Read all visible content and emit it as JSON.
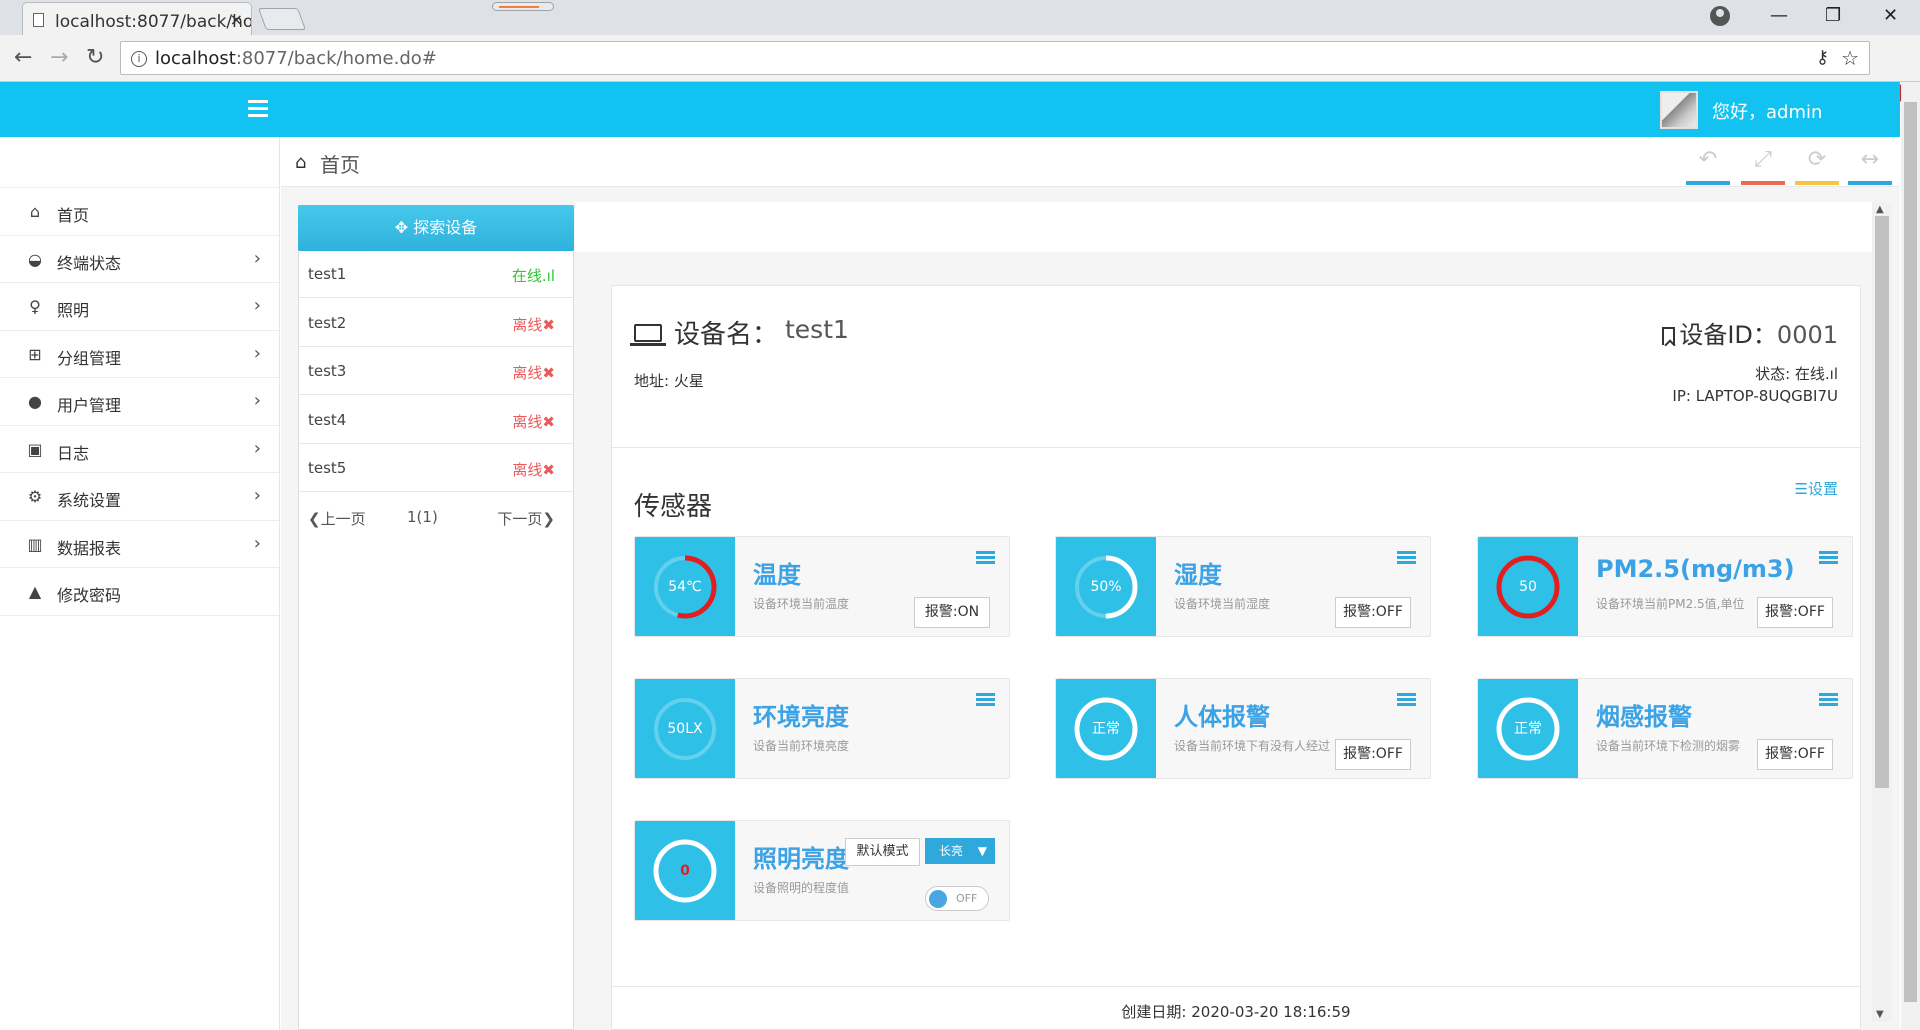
{
  "browser": {
    "tab_title": "localhost:8077/back/ho",
    "tab_close": "×",
    "url_host": "localhost",
    "url_path": ":8077/back/home.do#",
    "back": "←",
    "forward": "→",
    "reload": "↻",
    "info": "i",
    "key": "⚷",
    "star": "☆",
    "minimize": "—",
    "restore": "❐",
    "close": "✕",
    "ext": "●"
  },
  "header": {
    "greeting": "您好，admin"
  },
  "sidebar": {
    "items": [
      {
        "label": "首页",
        "icon": "home-icon",
        "glyph": "⌂",
        "arrow": ""
      },
      {
        "label": "终端状态",
        "icon": "dashboard-icon",
        "glyph": "◒",
        "arrow": "›"
      },
      {
        "label": "照明",
        "icon": "lightbulb-icon",
        "glyph": "♀",
        "arrow": "›"
      },
      {
        "label": "分组管理",
        "icon": "sitemap-icon",
        "glyph": "⊞",
        "arrow": "›"
      },
      {
        "label": "用户管理",
        "icon": "user-icon",
        "glyph": "●",
        "arrow": "›"
      },
      {
        "label": "日志",
        "icon": "archive-icon",
        "glyph": "▣",
        "arrow": "›"
      },
      {
        "label": "系统设置",
        "icon": "gears-icon",
        "glyph": "⚙",
        "arrow": "›"
      },
      {
        "label": "数据报表",
        "icon": "bar-chart-icon",
        "glyph": "▥",
        "arrow": "›"
      },
      {
        "label": "修改密码",
        "icon": "lock-icon",
        "glyph": "▲",
        "arrow": ""
      }
    ]
  },
  "breadcrumb": {
    "home_glyph": "⌂",
    "label": "首页"
  },
  "toolbar": {
    "back_glyph": "↶",
    "fullscreen_glyph": "⤢",
    "refresh_glyph": "⟳",
    "width_glyph": "↔",
    "colors": [
      "#2fa8dc",
      "#e96b56",
      "#f4c542",
      "#2fa8dc"
    ]
  },
  "device_list": {
    "search_label": "✥ 探索设备",
    "devices": [
      {
        "name": "test1",
        "status": "在线.ıl",
        "online": true
      },
      {
        "name": "test2",
        "status": "离线✖",
        "online": false
      },
      {
        "name": "test3",
        "status": "离线✖",
        "online": false
      },
      {
        "name": "test4",
        "status": "离线✖",
        "online": false
      },
      {
        "name": "test5",
        "status": "离线✖",
        "online": false
      }
    ],
    "prev": "❮上一页",
    "page": "1(1)",
    "next": "下一页❯"
  },
  "device": {
    "name_label": "设备名：",
    "name": "test1",
    "address": "地址: 火星",
    "id_label": "设备ID：",
    "id": "0001",
    "state": "状态: 在线.ıl",
    "ip": "IP: LAPTOP-8UQGBI7U",
    "created": "创建日期: 2020-03-20 18:16:59"
  },
  "sensors": {
    "title": "传感器",
    "settings": "☰设置",
    "tiles": [
      {
        "title": "温度",
        "value": "54℃",
        "desc": "设备环境当前温度",
        "alarm": "报警:ON",
        "fill": 0.54,
        "ring_color": "#e11f1f"
      },
      {
        "title": "湿度",
        "value": "50%",
        "desc": "设备环境当前湿度",
        "alarm": "报警:OFF",
        "fill": 0.5,
        "ring_color": "#ffffff"
      },
      {
        "title": "PM2.5(mg/m3)",
        "value": "50",
        "desc": "设备环境当前PM2.5值,单位",
        "alarm": "报警:OFF",
        "fill": 1.0,
        "ring_color": "#e11f1f"
      },
      {
        "title": "环境亮度",
        "value": "50LX",
        "desc": "设备当前环境亮度",
        "alarm": "",
        "fill": 0.0,
        "ring_color": "#ffffff"
      },
      {
        "title": "人体报警",
        "value": "正常",
        "desc": "设备当前环境下有没有人经过",
        "alarm": "报警:OFF",
        "fill": 1.0,
        "ring_color": "#ffffff"
      },
      {
        "title": "烟感报警",
        "value": "正常",
        "desc": "设备当前环境下检测的烟雾",
        "alarm": "报警:OFF",
        "fill": 1.0,
        "ring_color": "#ffffff"
      }
    ],
    "lighting": {
      "title": "照明亮度",
      "value": "0",
      "desc": "设备照明的程度值",
      "mode": "默认模式",
      "select": "长亮",
      "select_arrow": "▼",
      "toggle": "OFF",
      "fill": 1.0,
      "ring_color": "#ffffff"
    }
  }
}
